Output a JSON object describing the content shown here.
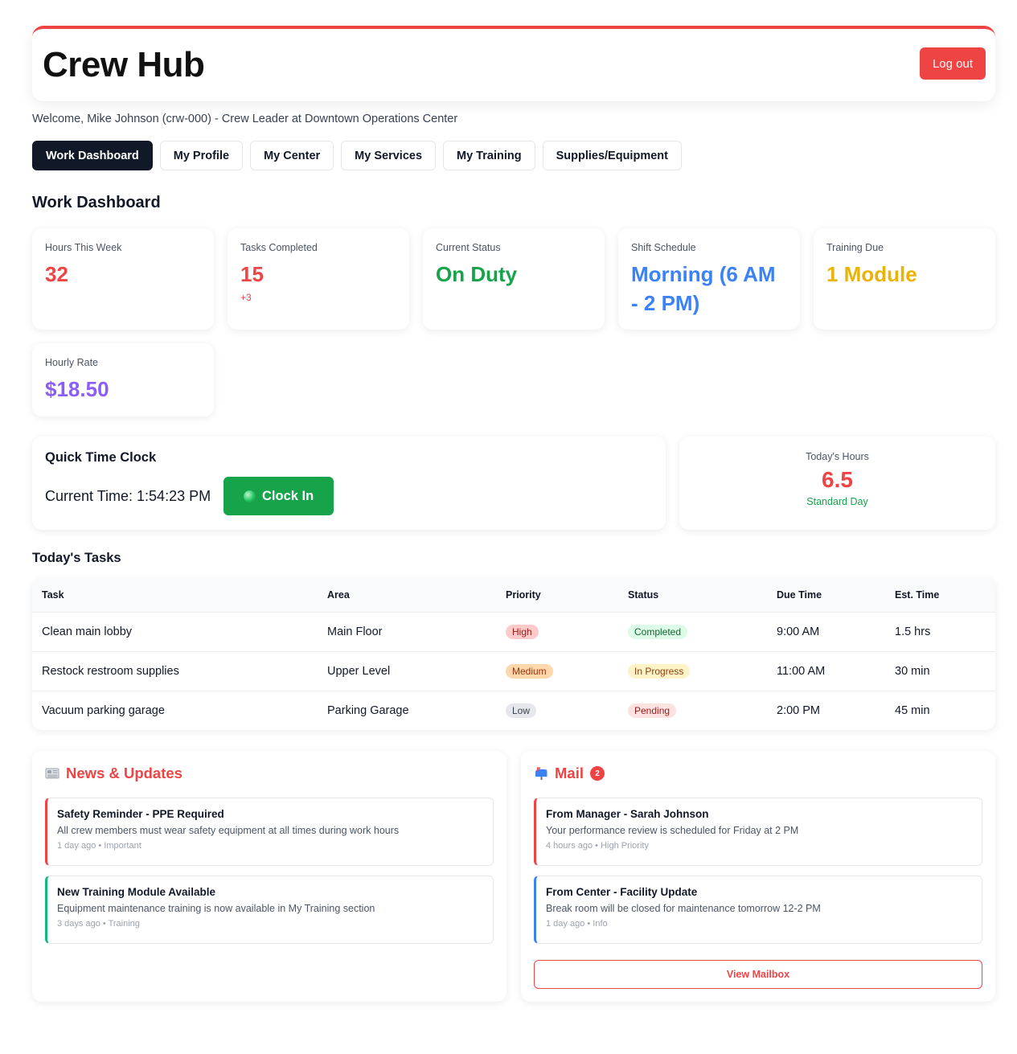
{
  "app": {
    "title": "Crew Hub",
    "logout_label": "Log out"
  },
  "welcome": "Welcome, Mike Johnson (crw-000) - Crew Leader at Downtown Operations Center",
  "tabs": [
    "Work Dashboard",
    "My Profile",
    "My Center",
    "My Services",
    "My Training",
    "Supplies/Equipment"
  ],
  "dashboard": {
    "title": "Work Dashboard",
    "stats": [
      {
        "label": "Hours This Week",
        "value": "32",
        "color": "#ef4444"
      },
      {
        "label": "Tasks Completed",
        "value": "15",
        "sub": "+3",
        "color": "#ef4444"
      },
      {
        "label": "Current Status",
        "value": "On Duty",
        "color": "#16a34a"
      },
      {
        "label": "Shift Schedule",
        "value": "Morning (6 AM - 2 PM)",
        "color": "#3b82f6"
      },
      {
        "label": "Training Due",
        "value": "1 Module",
        "color": "#eab308"
      },
      {
        "label": "Hourly Rate",
        "value": "$18.50",
        "color": "#8b5cf6"
      }
    ]
  },
  "time_clock": {
    "title": "Quick Time Clock",
    "current_time": "Current Time: 1:54:23 PM",
    "button_label": "Clock In",
    "today_label": "Today's Hours",
    "today_value": "6.5",
    "today_sub": "Standard Day"
  },
  "tasks": {
    "title": "Today's Tasks",
    "headers": [
      "Task",
      "Area",
      "Priority",
      "Status",
      "Due Time",
      "Est. Time"
    ],
    "rows": [
      {
        "task": "Clean main lobby",
        "area": "Main Floor",
        "priority": "High",
        "status": "Completed",
        "due": "9:00 AM",
        "est": "1.5 hrs"
      },
      {
        "task": "Restock restroom supplies",
        "area": "Upper Level",
        "priority": "Medium",
        "status": "In Progress",
        "due": "11:00 AM",
        "est": "30 min"
      },
      {
        "task": "Vacuum parking garage",
        "area": "Parking Garage",
        "priority": "Low",
        "status": "Pending",
        "due": "2:00 PM",
        "est": "45 min"
      }
    ]
  },
  "news": {
    "title": "News & Updates",
    "icon": "newspaper-icon",
    "items": [
      {
        "title": "Safety Reminder - PPE Required",
        "body": "All crew members must wear safety equipment at all times during work hours",
        "meta": "1 day ago • Important",
        "accent": "#ef4444"
      },
      {
        "title": "New Training Module Available",
        "body": "Equipment maintenance training is now available in My Training section",
        "meta": "3 days ago • Training",
        "accent": "#10b981"
      }
    ]
  },
  "mail": {
    "title": "Mail",
    "icon": "mailbox-icon",
    "badge": "2",
    "items": [
      {
        "title": "From Manager - Sarah Johnson",
        "body": "Your performance review is scheduled for Friday at 2 PM",
        "meta": "4 hours ago • High Priority",
        "accent": "#ef4444"
      },
      {
        "title": "From Center - Facility Update",
        "body": "Break room will be closed for maintenance tomorrow 12-2 PM",
        "meta": "1 day ago • Info",
        "accent": "#3b82f6"
      }
    ],
    "button_label": "View Mailbox"
  }
}
